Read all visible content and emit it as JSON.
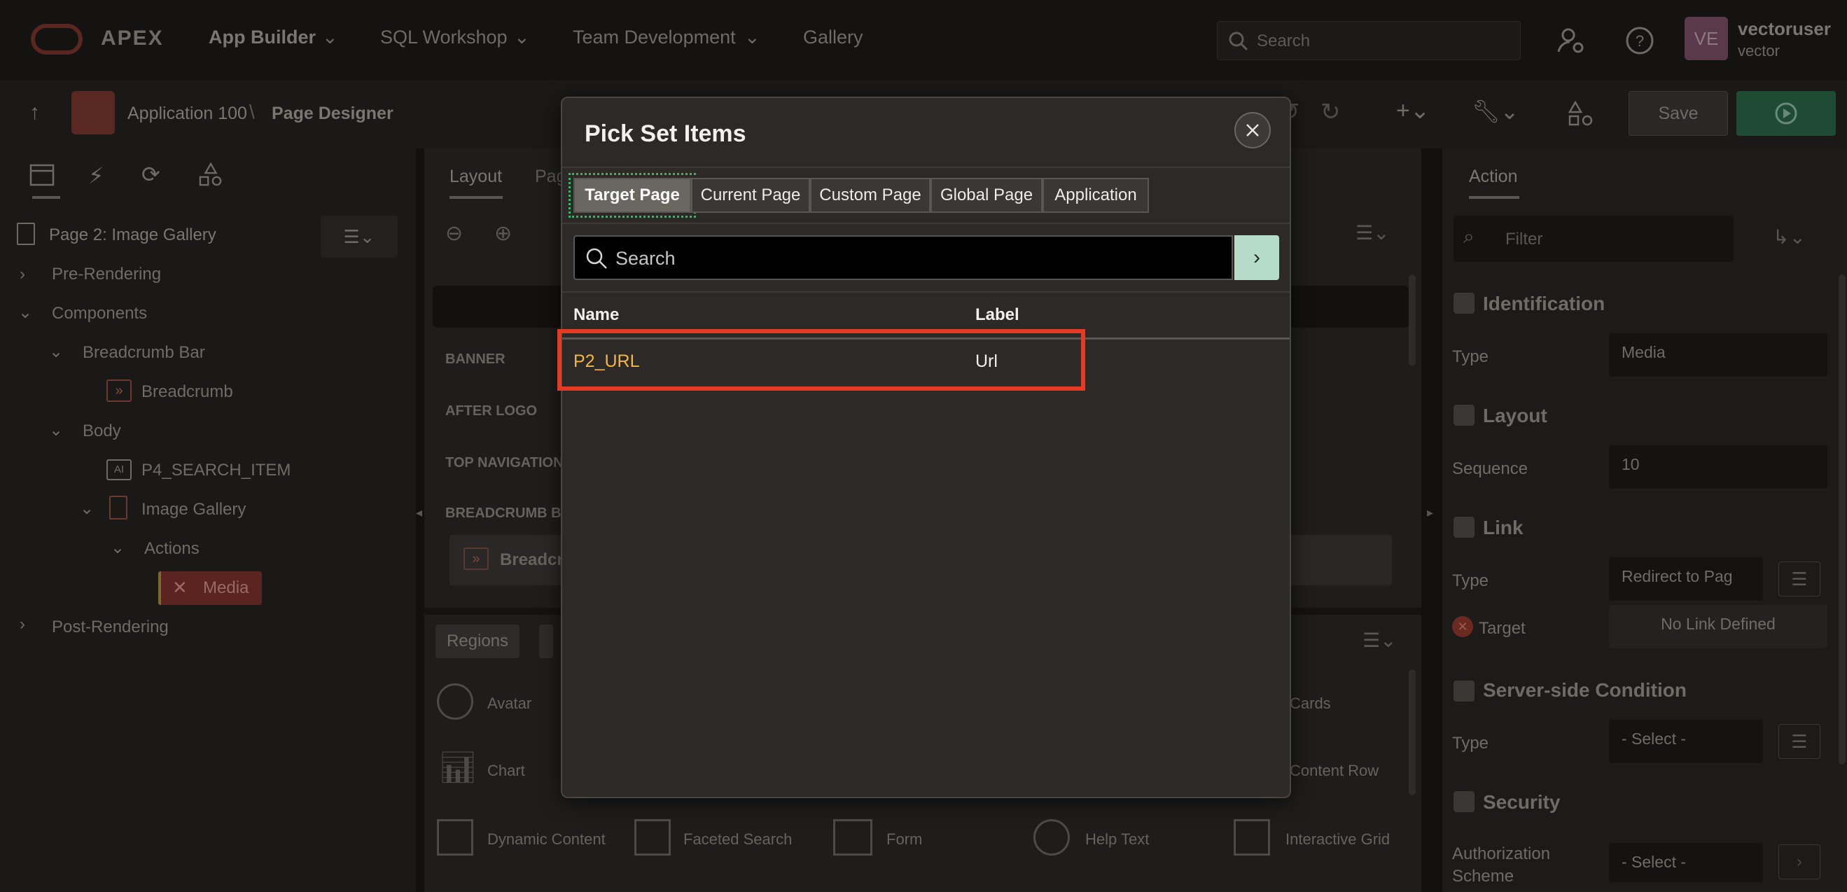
{
  "topnav": {
    "brand": "APEX",
    "items": [
      "App Builder",
      "SQL Workshop",
      "Team Development",
      "Gallery"
    ],
    "search_placeholder": "Search",
    "user": {
      "initials": "VE",
      "name": "vectoruser",
      "workspace": "vector"
    }
  },
  "toolbar": {
    "breadcrumb": [
      "Application 100",
      "Page Designer"
    ],
    "save_label": "Save"
  },
  "left_panel": {
    "page_title": "Page 2: Image Gallery",
    "tree": [
      {
        "label": "Pre-Rendering",
        "level": 0
      },
      {
        "label": "Components",
        "level": 0
      },
      {
        "label": "Breadcrumb Bar",
        "level": 1
      },
      {
        "label": "Breadcrumb",
        "level": 2
      },
      {
        "label": "Body",
        "level": 1
      },
      {
        "label": "P4_SEARCH_ITEM",
        "level": 2
      },
      {
        "label": "Image Gallery",
        "level": 2
      },
      {
        "label": "Actions",
        "level": 3
      },
      {
        "label": "Media",
        "level": 4
      },
      {
        "label": "Post-Rendering",
        "level": 0
      }
    ]
  },
  "center_panel": {
    "tabs": [
      "Layout",
      "Pag"
    ],
    "positions": [
      "BANNER",
      "AFTER LOGO",
      "TOP NAVIGATION",
      "BREADCRUMB BA"
    ],
    "breadcrumb_region": "Breadcru",
    "gallery_tab": "Regions",
    "gallery_items": [
      "Avatar",
      "Chart",
      "Dynamic Content",
      "Faceted Search",
      "Form",
      "Help Text",
      "Interactive Grid",
      "Cards",
      "Content Row"
    ]
  },
  "right_panel": {
    "tab": "Action",
    "filter_placeholder": "Filter",
    "sections": {
      "identification": {
        "title": "Identification",
        "type_label": "Type",
        "type_value": "Media"
      },
      "layout": {
        "title": "Layout",
        "sequence_label": "Sequence",
        "sequence_value": "10"
      },
      "link": {
        "title": "Link",
        "type_label": "Type",
        "type_value": "Redirect to Pag",
        "target_label": "Target",
        "target_value": "No Link Defined"
      },
      "condition": {
        "title": "Server-side Condition",
        "type_label": "Type",
        "type_value": "- Select -"
      },
      "security": {
        "title": "Security",
        "auth_label_1": "Authorization",
        "auth_label_2": "Scheme",
        "auth_value": "- Select -"
      }
    }
  },
  "modal": {
    "title": "Pick Set Items",
    "tabs": [
      "Target Page",
      "Current Page",
      "Custom Page",
      "Global Page",
      "Application"
    ],
    "active_tab": "Target Page",
    "search_placeholder": "Search",
    "columns": {
      "name": "Name",
      "label": "Label"
    },
    "rows": [
      {
        "name": "P2_URL",
        "label": "Url"
      }
    ]
  },
  "colors": {
    "highlight": "#e53b24",
    "item_name": "#f6b73c",
    "go_button": "#b5dcc6"
  }
}
